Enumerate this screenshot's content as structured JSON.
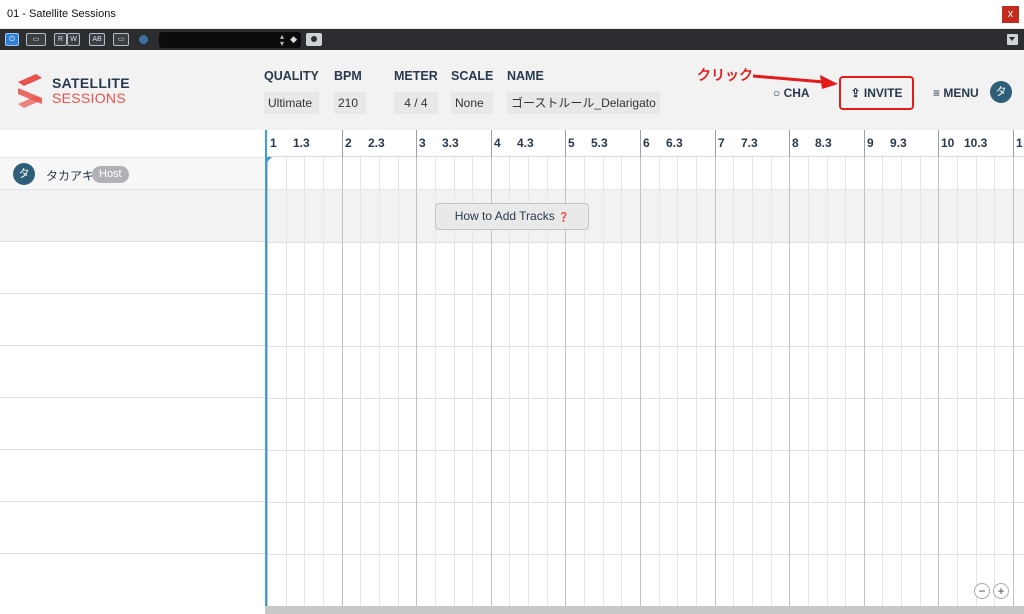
{
  "window": {
    "title": "01 - Satellite Sessions",
    "close": "x"
  },
  "host_toolbar": {
    "buttons": [
      "R",
      "W",
      "AB"
    ]
  },
  "logo": {
    "line1": "SATELLITE",
    "line2": "SESSIONS"
  },
  "header": {
    "quality_label": "QUALITY",
    "quality_value": "Ultimate",
    "bpm_label": "BPM",
    "bpm_value": "210",
    "meter_label": "METER",
    "meter_value": "4 / 4",
    "scale_label": "SCALE",
    "scale_value": "None",
    "name_label": "NAME",
    "name_value": "ゴーストルール_Delarigato",
    "chat": "CHA",
    "invite": "INVITE",
    "menu": "MENU",
    "avatar": "タ"
  },
  "annotation": {
    "text": "クリック",
    "color": "#e31b1b"
  },
  "track": {
    "avatar": "タ",
    "name": "タカアキ",
    "badge": "Host"
  },
  "ruler": [
    "1",
    "1.3",
    "2",
    "2.3",
    "3",
    "3.3",
    "4",
    "4.3",
    "5",
    "5.3",
    "6",
    "6.3",
    "7",
    "7.3",
    "8",
    "8.3",
    "9",
    "9.3",
    "10",
    "10.3",
    "1"
  ],
  "help_button": "How to Add Tracks",
  "zoom": {
    "minus": "−",
    "plus": "+"
  },
  "colors": {
    "accent": "#3aa0d6",
    "brand_red": "#e8524a",
    "navy": "#283a4d"
  }
}
